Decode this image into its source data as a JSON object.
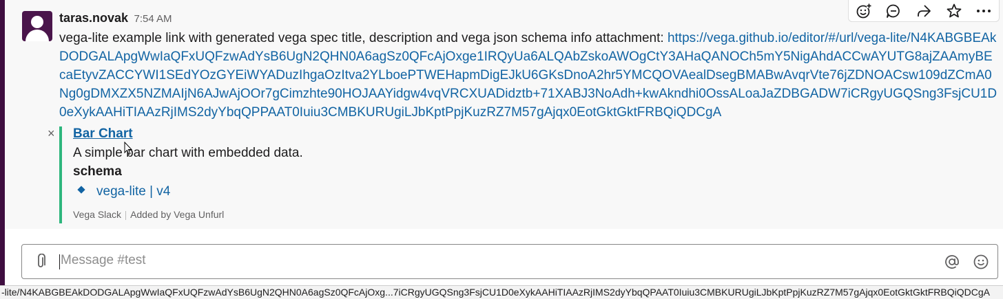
{
  "message": {
    "username": "taras.novak",
    "timestamp": "7:54 AM",
    "text": "vega-lite example link with generated vega spec title, description and vega json schema info attachment: ",
    "link": "https://vega.github.io/editor/#/url/vega-lite/N4KABGBEAkDODGALApgWwIaQFxUQFzwAdYsB6UgN2QHN0A6agSz0QFcAjOxge1IRQyUa6ALQAbZskoAWOgCtY3AHaQANOCh5mY5NigAhdACCwAYUTG8ajZAAmyBEcaEtyvZACCYWI1SEdYOzGYEiWYADuzIhgaOzItva2YLboePTWEHapmDigEJkU6GKsDnoA2hr5YMCQOVAealDsegBMABwAvqrVte76jZDNOACsw109dZCmA0Ng0gDMXZX5NZMAIjN6AJwAjOOr7gCimzhte90HOJAAYidgw4vqVRCXUADidztb+71XABJ3NoAdh+kwAkndhi0OssALoaJaZDBGADW7iCRgyUGQSng3FsjCU1D0eXykAAHiTIAAzRjIMS2dyYbqQPPAAT0Iuiu3CMBKURUgiLJbKptPpjKuzRZ7M57gAjqx0EotGktGktFRBQiQDCgA",
    "avatar_alt": "avatar"
  },
  "attachment": {
    "close_glyph": "×",
    "title": "Bar Chart",
    "description": "A simple bar chart with embedded data.",
    "field_title": "schema",
    "field_value": "vega-lite | v4",
    "footer_app": "Vega Slack",
    "footer_added": "Added by Vega Unfurl",
    "accent_color": "#2eb67d"
  },
  "actions": [
    {
      "name": "add-reaction-icon"
    },
    {
      "name": "reply-thread-icon"
    },
    {
      "name": "share-message-icon"
    },
    {
      "name": "save-star-icon"
    },
    {
      "name": "more-actions-icon"
    }
  ],
  "composer": {
    "placeholder": "Message #test",
    "attach_icon": "paperclip-icon",
    "mention_icon": "at-sign-icon",
    "emoji_icon": "emoji-icon"
  },
  "status_bar": {
    "url": "-lite/N4KABGBEAkDODGALApgWwIaQFxUQFzwAdYsB6UgN2QHN0A6agSz0QFcAjOxg...7iCRgyUGQSng3FsjCU1D0eXykAAHiTIAAzRjIMS2dyYbqQPAAT0Iuiu3CMBKURUgiLJbKptPpjKuzRZ7M57gAjqx0EotGktGktFRBQiQDCgA"
  },
  "colors": {
    "link": "#1264a3",
    "sidebar": "#3f0e40",
    "avatar": "#4a154b"
  }
}
